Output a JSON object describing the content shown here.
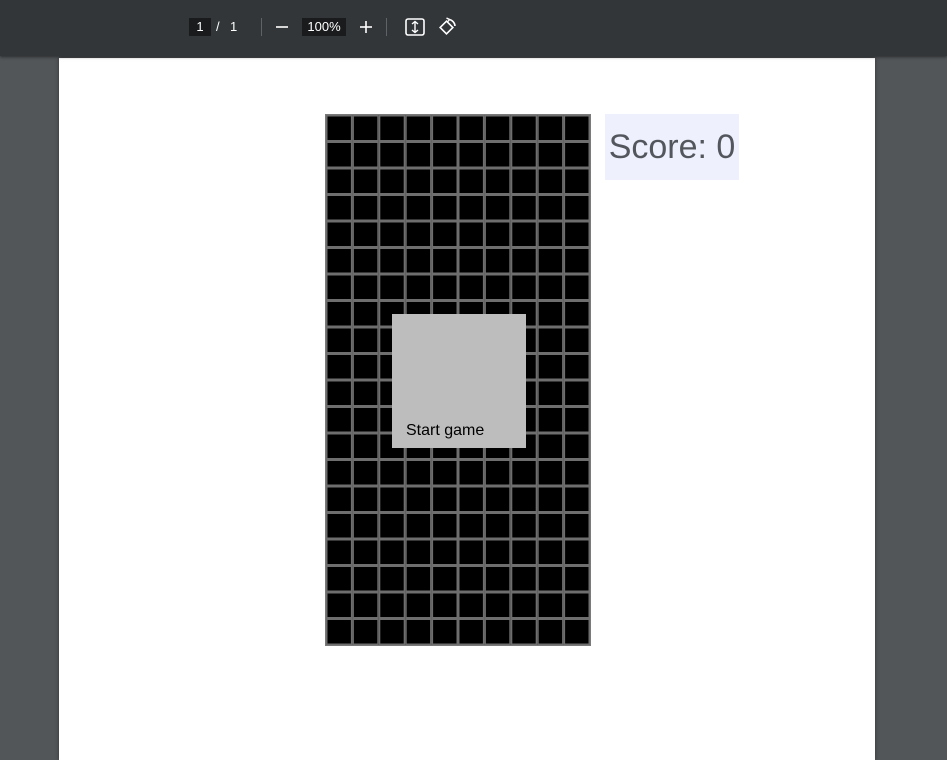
{
  "toolbar": {
    "current_page": "1",
    "separator": "/",
    "total_pages": "1",
    "zoom_value": "100%"
  },
  "game": {
    "start_label": "Start game",
    "score_label": "Score: 0",
    "board_columns": 10,
    "board_rows": 20,
    "cell_fill": "#000000",
    "grid_line_color": "#6e6e6e",
    "panel_color": "#bdbdbd",
    "score_bg": "#eef0fd"
  },
  "icons": {
    "zoom_out": "minus-icon",
    "zoom_in": "plus-icon",
    "fit": "fit-to-page-icon",
    "rotate": "rotate-icon"
  }
}
